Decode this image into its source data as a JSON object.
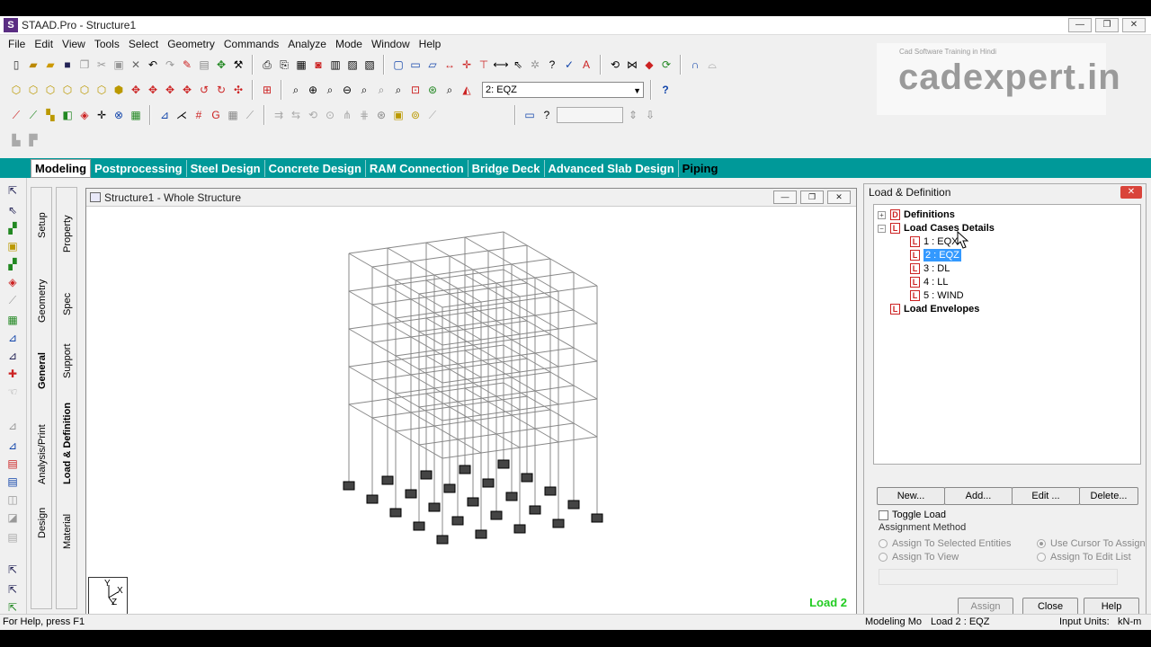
{
  "window": {
    "title": "STAAD.Pro - Structure1",
    "controls": [
      "—",
      "❐",
      "✕"
    ]
  },
  "menu": [
    "File",
    "Edit",
    "View",
    "Tools",
    "Select",
    "Geometry",
    "Commands",
    "Analyze",
    "Mode",
    "Window",
    "Help"
  ],
  "toolbar": {
    "load_case_combo": "2: EQZ",
    "help_icon": "?"
  },
  "watermark": {
    "small": "Cad Software Training in Hindi",
    "big": "cadexpert.in"
  },
  "tabs": [
    "Modeling",
    "Postprocessing",
    "Steel Design",
    "Concrete Design",
    "RAM Connection",
    "Bridge Deck",
    "Advanced Slab Design",
    "Piping"
  ],
  "left_vtabs_1": [
    "Setup",
    "Geometry",
    "General",
    "Analysis/Print",
    "Design"
  ],
  "left_vtabs_2": [
    "Property",
    "Spec",
    "Support",
    "Load & Definition",
    "Material"
  ],
  "viewport": {
    "title": "Structure1 - Whole Structure",
    "load_label": "Load 2",
    "axes": {
      "y": "Y",
      "x": "X",
      "z": "Z"
    }
  },
  "panel": {
    "title": "Load & Definition",
    "tree": {
      "definitions": "Definitions",
      "load_cases": "Load Cases Details",
      "items": [
        "1 : EQX",
        "2 : EQZ",
        "3 : DL",
        "4 : LL",
        "5 : WIND"
      ],
      "envelopes": "Load Envelopes"
    },
    "buttons": {
      "new": "New...",
      "add": "Add...",
      "edit": "Edit ...",
      "delete": "Delete..."
    },
    "toggle_load": "Toggle Load",
    "assignment_method": "Assignment Method",
    "radios": {
      "selected": "Assign To Selected Entities",
      "view": "Assign To View",
      "cursor": "Use Cursor To Assign",
      "edit_list": "Assign To Edit List"
    },
    "bottom_buttons": {
      "assign": "Assign",
      "close": "Close",
      "help": "Help"
    }
  },
  "status": {
    "help": "For Help, press F1",
    "mode": "Modeling Mo",
    "load": "Load 2 : EQZ",
    "units_label": "Input Units:",
    "units": "kN-m"
  }
}
